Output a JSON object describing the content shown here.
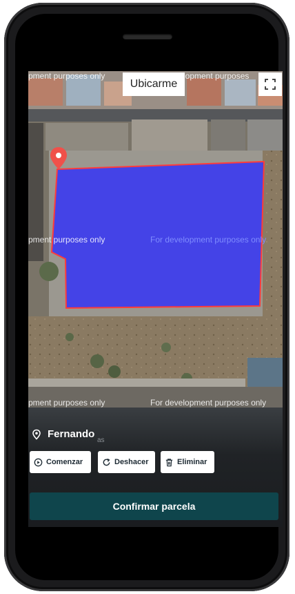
{
  "map": {
    "locate_button": "Ubicarme",
    "watermark_text": "For development purposes only",
    "watermark_left_fragment": "pment purposes only",
    "watermark_top_left": "pment purposes only",
    "watermark_top_right": "lopment purposes"
  },
  "parcel": {
    "location_name": "Fernando",
    "location_subtext": "as"
  },
  "actions": {
    "start": "Comenzar",
    "undo": "Deshacer",
    "delete": "Eliminar",
    "confirm": "Confirmar parcela"
  },
  "colors": {
    "polygon_fill": "#2b2bff",
    "polygon_stroke": "#ff3b3b",
    "marker": "#f0504a",
    "confirm_button": "#0f454c"
  },
  "icons": {
    "location": "location-pin-icon",
    "start": "play-circle-icon",
    "undo": "undo-icon",
    "delete": "trash-icon",
    "fullscreen": "fullscreen-icon"
  }
}
